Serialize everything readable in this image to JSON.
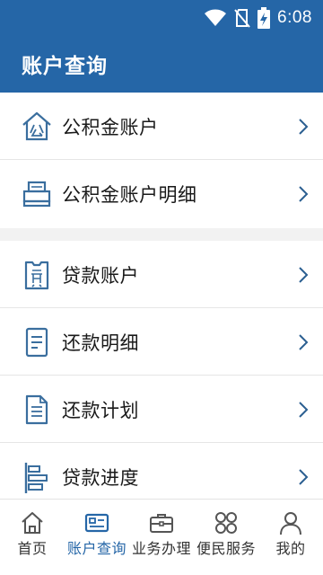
{
  "status_bar": {
    "time": "6:08",
    "icons": [
      "wifi-icon",
      "no-sim-icon",
      "battery-charging-icon"
    ]
  },
  "header": {
    "title": "账户查询"
  },
  "section_fund": {
    "items": [
      {
        "label": "公积金账户",
        "icon": "house-fund-icon"
      },
      {
        "label": "公积金账户明细",
        "icon": "printer-icon"
      }
    ]
  },
  "section_loan": {
    "items": [
      {
        "label": "贷款账户",
        "icon": "loan-tag-icon"
      },
      {
        "label": "还款明细",
        "icon": "document-icon"
      },
      {
        "label": "还款计划",
        "icon": "document-lines-icon"
      },
      {
        "label": "贷款进度",
        "icon": "progress-bars-icon"
      }
    ]
  },
  "tab_bar": {
    "items": [
      {
        "label": "首页",
        "icon": "home-icon",
        "active": false
      },
      {
        "label": "账户查询",
        "icon": "id-card-icon",
        "active": true
      },
      {
        "label": "业务办理",
        "icon": "briefcase-icon",
        "active": false
      },
      {
        "label": "便民服务",
        "icon": "clover-grid-icon",
        "active": false
      },
      {
        "label": "我的",
        "icon": "user-icon",
        "active": false
      }
    ]
  },
  "colors": {
    "primary": "#2566a7",
    "icon_stroke": "#3a6e9e",
    "background": "#f2f2f2",
    "chevron": "#2b5f91"
  }
}
